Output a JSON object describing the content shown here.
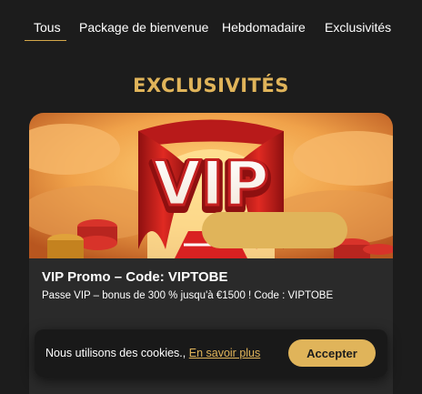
{
  "tabs": [
    {
      "label": "Tous",
      "active": true
    },
    {
      "label": "Package de bienvenue",
      "active": false
    },
    {
      "label": "Hebdomadaire",
      "active": false
    },
    {
      "label": "Exclusivités",
      "active": false
    }
  ],
  "section": {
    "title": "EXCLUSIVITÉS"
  },
  "promo": {
    "banner_text": "VIP",
    "title": "VIP Promo – Code: VIPTOBE",
    "description": "Passe VIP – bonus de 300 % jusqu'à €1500 ! Code : VIPTOBE"
  },
  "cookie": {
    "message": "Nous utilisons des cookies.,",
    "link_label": "En savoir plus",
    "accept_label": "Accepter"
  },
  "colors": {
    "background": "#1c1c1c",
    "accent_gold": "#e0b45a",
    "card_body": "#2a2a2a",
    "curtain_red": "#c41e1e"
  }
}
